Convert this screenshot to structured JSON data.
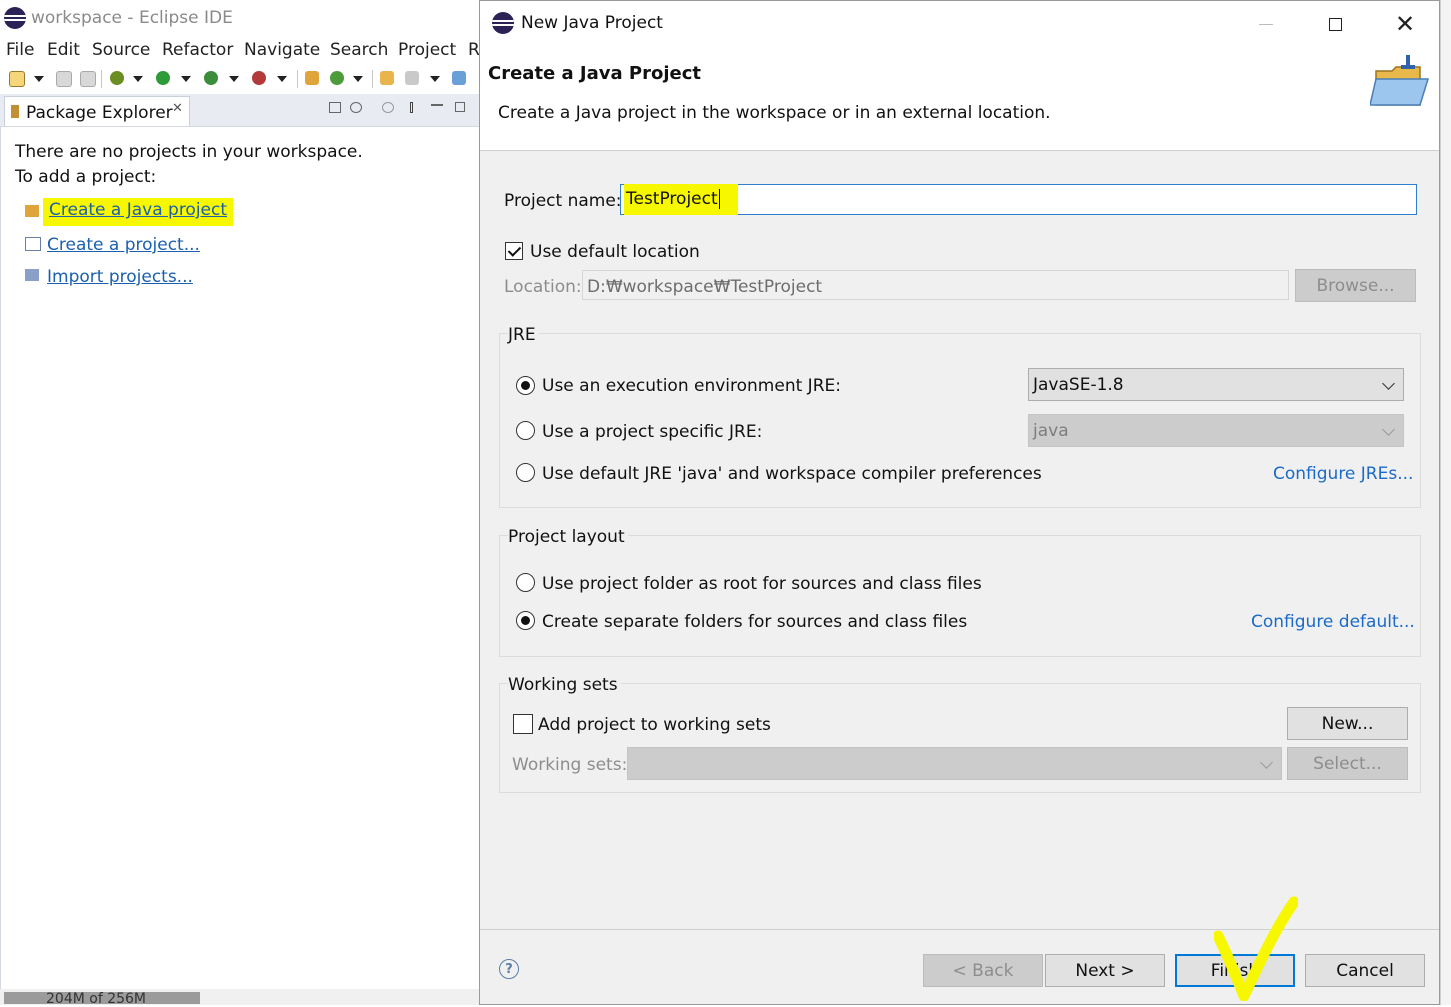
{
  "main_window": {
    "title": "workspace - Eclipse IDE",
    "menu": [
      "File",
      "Edit",
      "Source",
      "Refactor",
      "Navigate",
      "Search",
      "Project",
      "R"
    ],
    "package_explorer": {
      "tab_label": "Package Explorer",
      "tab_close": "✕",
      "empty_line1": "There are no projects in your workspace.",
      "empty_line2": "To add a project:",
      "links": [
        "Create a Java project",
        "Create a project...",
        "Import projects..."
      ]
    },
    "status_text": "204M of 256M"
  },
  "dialog": {
    "window_title": "New Java Project",
    "header_title": "Create a Java Project",
    "header_description": "Create a Java project in the workspace or in an external location.",
    "project_name_label": "Project name:",
    "project_name_value": "TestProject",
    "use_default_location_label": "Use default location",
    "use_default_location_checked": true,
    "location_label": "Location:",
    "location_value": "D:₩workspace₩TestProject",
    "browse_label": "Browse...",
    "jre": {
      "group_title": "JRE",
      "option_exec_env": "Use an execution environment JRE:",
      "option_exec_env_value": "JavaSE-1.8",
      "option_project_specific": "Use a project specific JRE:",
      "option_project_specific_value": "java",
      "option_default": "Use default JRE 'java' and workspace compiler preferences",
      "configure_link": "Configure JREs...",
      "selected": "exec_env"
    },
    "project_layout": {
      "group_title": "Project layout",
      "option_root": "Use project folder as root for sources and class files",
      "option_separate": "Create separate folders for sources and class files",
      "configure_link": "Configure default...",
      "selected": "separate"
    },
    "working_sets": {
      "group_title": "Working sets",
      "add_label": "Add project to working sets",
      "add_checked": false,
      "new_button": "New...",
      "working_sets_label": "Working sets:",
      "select_button": "Select..."
    },
    "footer": {
      "help_icon": "?",
      "back_button": "< Back",
      "next_button": "Next >",
      "finish_button": "Finish",
      "cancel_button": "Cancel"
    }
  },
  "colors": {
    "highlight": "#f7f700",
    "link": "#1b6ac9",
    "focus_border": "#0078d7"
  }
}
